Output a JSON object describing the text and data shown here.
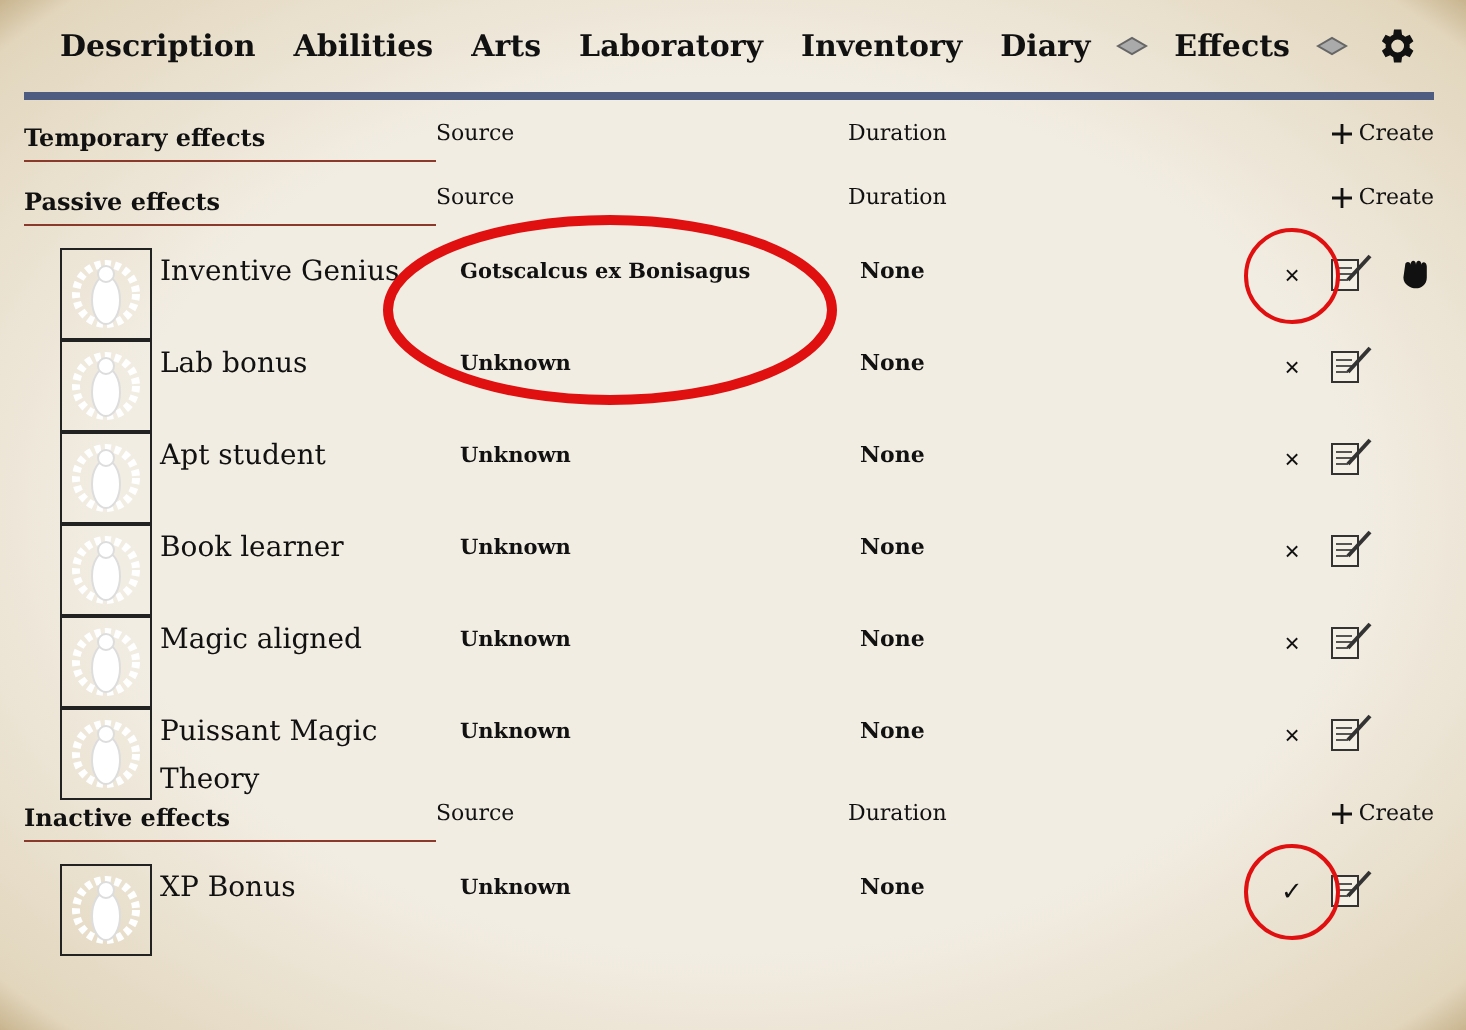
{
  "tabs": [
    {
      "label": "Description"
    },
    {
      "label": "Abilities"
    },
    {
      "label": "Arts"
    },
    {
      "label": "Laboratory"
    },
    {
      "label": "Inventory"
    },
    {
      "label": "Diary"
    },
    {
      "label": "Effects"
    }
  ],
  "sections": [
    {
      "title": "Temporary effects",
      "source_header": "Source",
      "duration_header": "Duration",
      "create": "Create"
    },
    {
      "title": "Passive effects",
      "source_header": "Source",
      "duration_header": "Duration",
      "create": "Create",
      "effects": [
        {
          "name": "Inventive Genius",
          "source": "Gotscalcus ex Bonisagus",
          "duration": "None",
          "toggle": "×",
          "linked": true,
          "source_circled": true,
          "toggle_circled": true
        },
        {
          "name": "Lab bonus",
          "source": "Unknown",
          "duration": "None",
          "toggle": "×",
          "linked": false,
          "source_circled": false,
          "toggle_circled": false
        },
        {
          "name": "Apt student",
          "source": "Unknown",
          "duration": "None",
          "toggle": "×",
          "linked": false,
          "source_circled": false,
          "toggle_circled": false
        },
        {
          "name": "Book learner",
          "source": "Unknown",
          "duration": "None",
          "toggle": "×",
          "linked": false,
          "source_circled": false,
          "toggle_circled": false
        },
        {
          "name": "Magic aligned",
          "source": "Unknown",
          "duration": "None",
          "toggle": "×",
          "linked": false,
          "source_circled": false,
          "toggle_circled": false
        },
        {
          "name": "Puissant Magic Theory",
          "source": "Unknown",
          "duration": "None",
          "toggle": "×",
          "linked": false,
          "source_circled": false,
          "toggle_circled": false
        }
      ]
    },
    {
      "title": "Inactive effects",
      "source_header": "Source",
      "duration_header": "Duration",
      "create": "Create",
      "effects": [
        {
          "name": "XP Bonus",
          "source": "Unknown",
          "duration": "None",
          "toggle": "✓",
          "linked": false,
          "source_circled": false,
          "toggle_circled": true
        }
      ]
    }
  ]
}
